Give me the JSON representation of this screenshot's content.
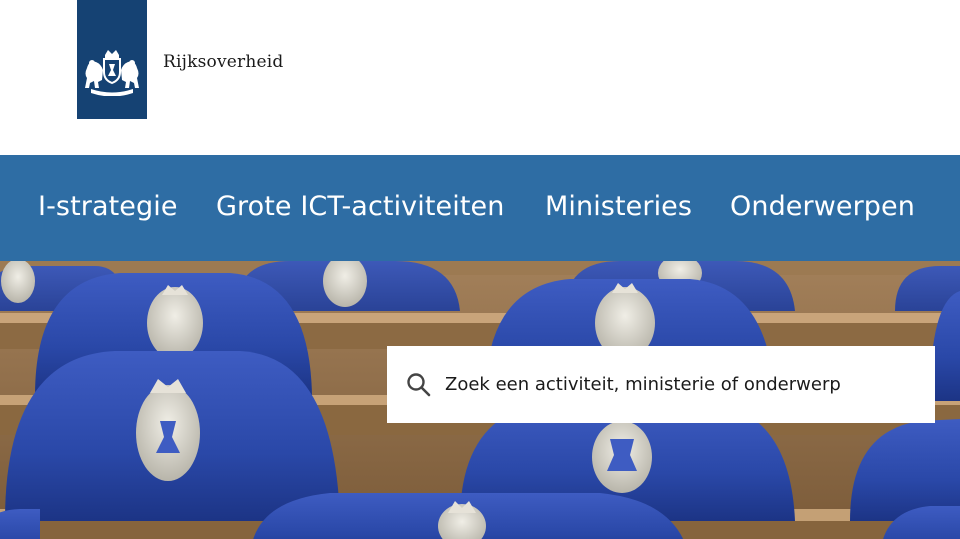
{
  "header": {
    "brand_name": "Rijksoverheid",
    "logo_color": "#154273"
  },
  "nav": {
    "background": "#2e6da4",
    "items": [
      {
        "label": "I-strategie"
      },
      {
        "label": "Grote ICT-activiteiten"
      },
      {
        "label": "Ministeries"
      },
      {
        "label": "Onderwerpen"
      }
    ]
  },
  "hero": {
    "icon": "parliament-seats-photo"
  },
  "search": {
    "placeholder": "Zoek een activiteit, ministerie of onderwerp",
    "value": "",
    "icon": "search-icon"
  }
}
